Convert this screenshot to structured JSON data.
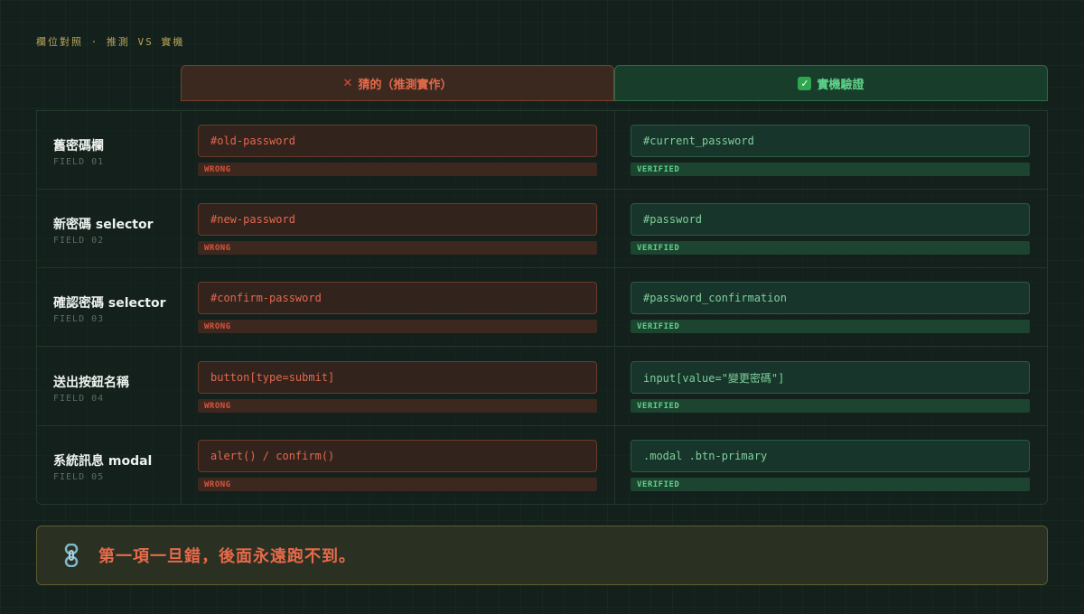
{
  "kicker": "欄位對照 · 推測 VS 實機",
  "columns": {
    "guess": {
      "icon": "cross-mark-icon",
      "glyph": "✕",
      "label": "猜的（推測實作）"
    },
    "real": {
      "icon": "check-mark-icon",
      "glyph": "✓",
      "label": "實機驗證"
    }
  },
  "rows": [
    {
      "name": "舊密碼欄",
      "id": "FIELD 01",
      "guess": "#old-password",
      "guess_tag": "WRONG",
      "real": "#current_password",
      "real_tag": "VERIFIED"
    },
    {
      "name": "新密碼 selector",
      "id": "FIELD 02",
      "guess": "#new-password",
      "guess_tag": "WRONG",
      "real": "#password",
      "real_tag": "VERIFIED"
    },
    {
      "name": "確認密碼 selector",
      "id": "FIELD 03",
      "guess": "#confirm-password",
      "guess_tag": "WRONG",
      "real": "#password_confirmation",
      "real_tag": "VERIFIED"
    },
    {
      "name": "送出按鈕名稱",
      "id": "FIELD 04",
      "guess": "button[type=submit]",
      "guess_tag": "WRONG",
      "real": "input[value=\"變更密碼\"]",
      "real_tag": "VERIFIED"
    },
    {
      "name": "系統訊息 modal",
      "id": "FIELD 05",
      "guess": "alert() / confirm()",
      "guess_tag": "WRONG",
      "real": ".modal .btn-primary",
      "real_tag": "VERIFIED"
    }
  ],
  "banner": {
    "icon": "chain-link-icon",
    "text": "第一項一旦錯，後面永遠跑不到。"
  },
  "colors": {
    "wrong": "#e8694a",
    "verified": "#5fd38a",
    "kicker": "#b9a45a"
  }
}
